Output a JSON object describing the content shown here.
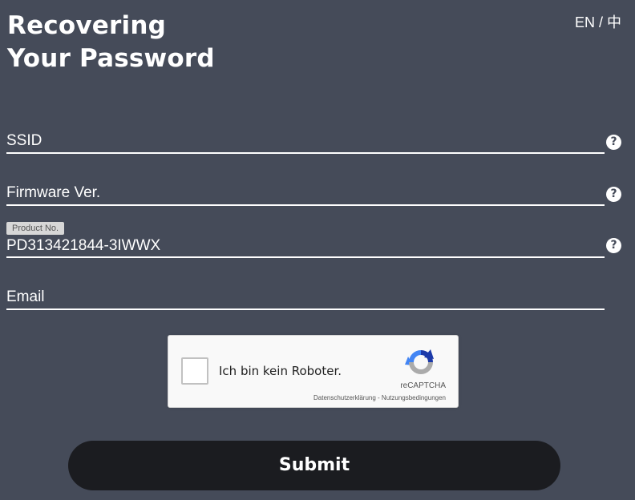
{
  "header": {
    "title_line1": "Recovering",
    "title_line2": "Your Password",
    "lang_en": "EN",
    "lang_sep": "/",
    "lang_zh": "中"
  },
  "form": {
    "ssid": {
      "label": "SSID",
      "value": "",
      "help_icon": "question-icon"
    },
    "firmware": {
      "label": "Firmware Ver.",
      "value": "",
      "help_icon": "question-icon"
    },
    "product": {
      "label": "Product No.",
      "value": "PD313421844-3IWWX",
      "help_icon": "question-icon"
    },
    "email": {
      "label": "Email",
      "value": ""
    }
  },
  "captcha": {
    "checkbox_label": "Ich bin kein Roboter.",
    "brand": "reCAPTCHA",
    "links": "Datenschutzerklärung - Nutzungsbedingungen",
    "checked": false
  },
  "submit": {
    "label": "Submit"
  },
  "colors": {
    "background": "#454b59",
    "button": "#1b1c20",
    "text": "#ffffff"
  }
}
